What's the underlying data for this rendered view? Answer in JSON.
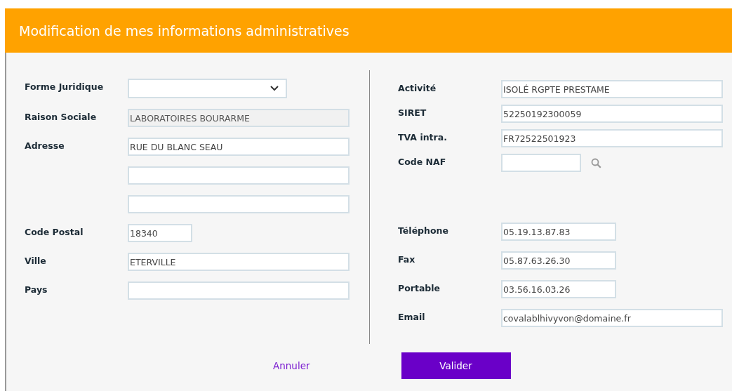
{
  "dialog": {
    "title": "Modification de mes informations administratives"
  },
  "left_rows": [
    {
      "label": "Forme Juridique",
      "fields": [
        {
          "kind": "select",
          "disabled": false
        }
      ]
    },
    {
      "label": "Raison Sociale",
      "fields": [
        {
          "kind": "text",
          "value": "LABORATOIRES BOURARME",
          "disabled": true
        }
      ]
    },
    {
      "label": "Adresse",
      "fields": [
        {
          "kind": "text",
          "value": "RUE DU BLANC SEAU",
          "disabled": false
        },
        {
          "kind": "text",
          "disabled": false
        },
        {
          "kind": "text",
          "disabled": false
        }
      ]
    },
    {
      "label": "Code Postal",
      "fields": [
        {
          "kind": "short",
          "value": "18340",
          "disabled": false
        }
      ]
    },
    {
      "label": "Ville",
      "fields": [
        {
          "kind": "text",
          "value": "ETERVILLE",
          "disabled": false
        }
      ]
    },
    {
      "label": "Pays",
      "fields": [
        {
          "kind": "text",
          "disabled": false
        }
      ]
    }
  ],
  "right_top_rows": [
    {
      "label": "Activité",
      "fields": [
        {
          "kind": "text",
          "value": "ISOLÉ RGPTE PRESTAME",
          "disabled": false
        }
      ]
    },
    {
      "label": "SIRET",
      "fields": [
        {
          "kind": "text",
          "value": "52250192300059",
          "disabled": false
        }
      ]
    },
    {
      "label": "TVA intra.",
      "fields": [
        {
          "kind": "text",
          "value": "FR72522501923",
          "disabled": false
        }
      ]
    },
    {
      "label": "Code NAF",
      "fields": [
        {
          "kind": "search",
          "disabled": false
        }
      ]
    }
  ],
  "right_bottom_rows": [
    {
      "label": "Téléphone",
      "fields": [
        {
          "kind": "medium",
          "value": "05.19.13.87.83",
          "disabled": false
        }
      ]
    },
    {
      "label": "Fax",
      "fields": [
        {
          "kind": "medium",
          "value": "05.87.63.26.30",
          "disabled": false
        }
      ]
    },
    {
      "label": "Portable",
      "fields": [
        {
          "kind": "medium",
          "value": "03.56.16.03.26",
          "disabled": false
        }
      ]
    },
    {
      "label": "Email",
      "fields": [
        {
          "kind": "text",
          "value": "covalablhivyvon@domaine.fr",
          "disabled": false
        }
      ]
    }
  ],
  "buttons": {
    "cancel": "Annuler",
    "submit": "Valider"
  }
}
